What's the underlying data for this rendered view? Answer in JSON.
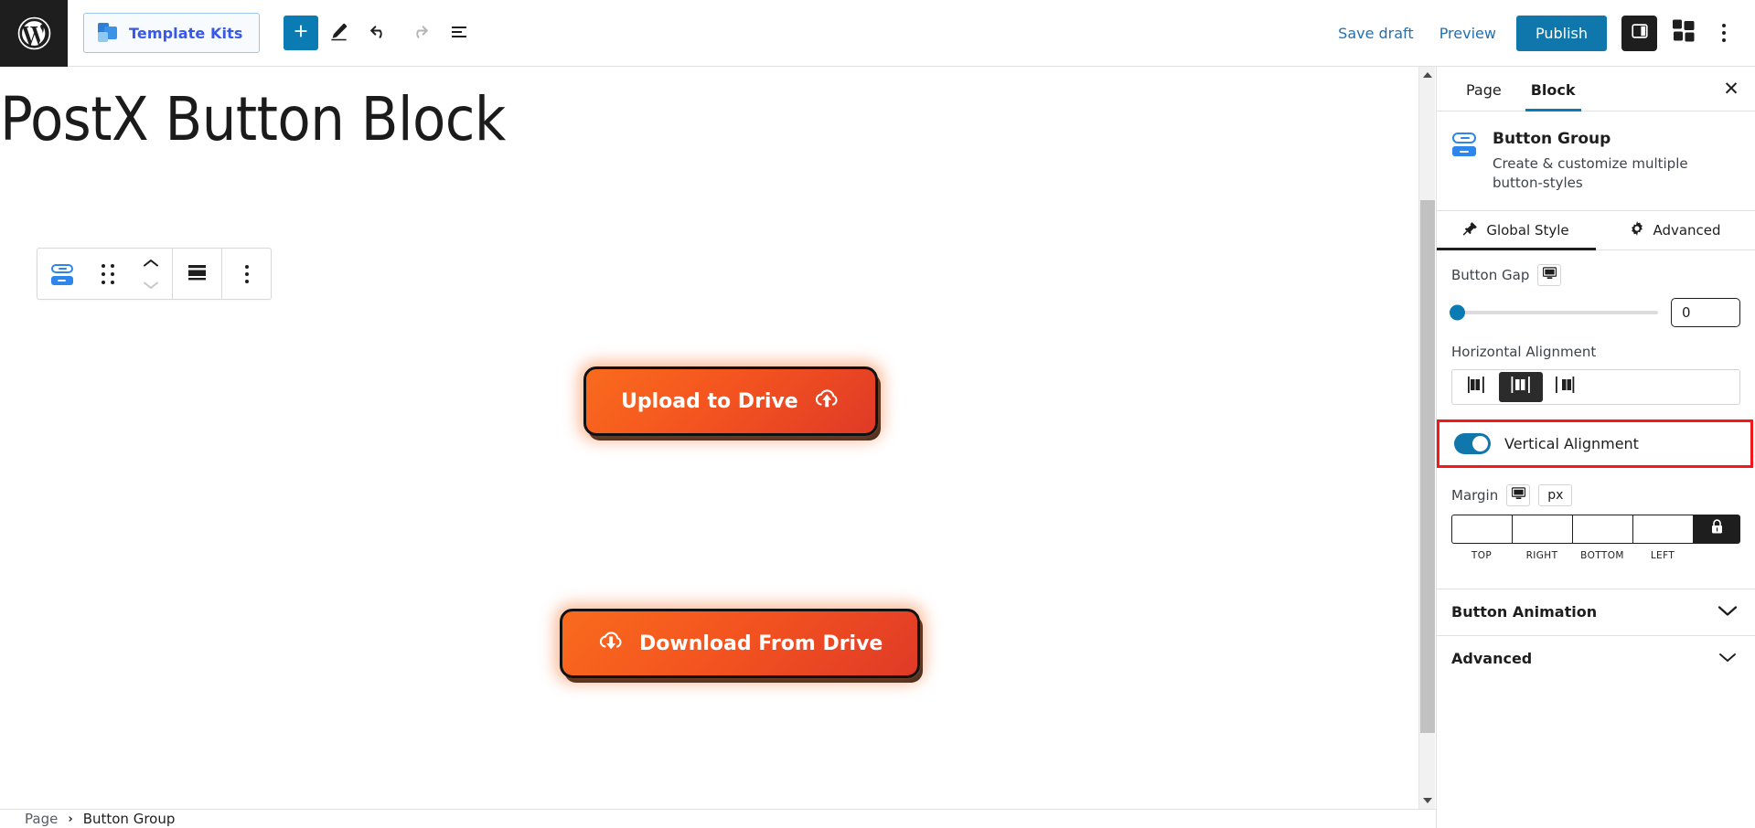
{
  "topbar": {
    "wp_logo": "wordpress-logo",
    "template_kits_label": "Template Kits",
    "add_block_label": "+",
    "icons": [
      "plus-icon",
      "edit-pencil-icon",
      "undo-icon",
      "redo-icon",
      "list-view-icon"
    ],
    "save_draft_label": "Save draft",
    "preview_label": "Preview",
    "publish_label": "Publish",
    "settings_toggle": "sidebar-toggle-icon",
    "blocks_icon": "blocks-grid-icon",
    "options_icon": "more-options-icon"
  },
  "canvas": {
    "post_title": "PostX Button Block",
    "block_toolbar": {
      "block_type_icon": "button-group-icon",
      "drag_handle": "drag-handle-icon",
      "move_up": "move-up-icon",
      "move_down": "move-down-icon",
      "align_icon": "align-icon",
      "more_icon": "more-options-icon"
    },
    "buttons": [
      {
        "label": "Upload to Drive",
        "icon": "cloud-upload-icon",
        "icon_position": "right"
      },
      {
        "label": "Download From Drive",
        "icon": "cloud-download-icon",
        "icon_position": "left"
      }
    ]
  },
  "breadcrumb": {
    "items": [
      "Page",
      "Button Group"
    ],
    "separator": "›"
  },
  "sidebar": {
    "tabs": [
      {
        "label": "Page",
        "active": false
      },
      {
        "label": "Block",
        "active": true
      }
    ],
    "close_label": "✕",
    "block": {
      "name": "Button Group",
      "description": "Create & customize multiple button-styles",
      "icon": "button-group-icon"
    },
    "subtabs": [
      {
        "label": "Global Style",
        "icon": "pin-icon",
        "active": true
      },
      {
        "label": "Advanced",
        "icon": "gear-icon",
        "active": false
      }
    ],
    "button_gap": {
      "label": "Button Gap",
      "device_icon": "desktop-icon",
      "value": "0",
      "slider_percent": 0
    },
    "horizontal_alignment": {
      "label": "Horizontal Alignment",
      "options": [
        {
          "name": "align-left",
          "selected": false
        },
        {
          "name": "align-center",
          "selected": true
        },
        {
          "name": "align-right",
          "selected": false
        }
      ]
    },
    "vertical_alignment": {
      "label": "Vertical Alignment",
      "enabled": true,
      "highlight_color": "#f41818"
    },
    "margin": {
      "label": "Margin",
      "device_icon": "desktop-icon",
      "unit": "px",
      "lock_icon": "lock-icon",
      "fields": [
        {
          "side": "TOP",
          "value": ""
        },
        {
          "side": "RIGHT",
          "value": ""
        },
        {
          "side": "BOTTOM",
          "value": ""
        },
        {
          "side": "LEFT",
          "value": ""
        }
      ]
    },
    "accordions": [
      {
        "label": "Button Animation",
        "expanded": false
      },
      {
        "label": "Advanced",
        "expanded": false
      }
    ]
  },
  "colors": {
    "brand_blue": "#0b7cb3",
    "link_blue": "#2171b1",
    "template_kits_purple": "#3858e9",
    "button_orange_start": "#f96b1e",
    "button_orange_end": "#e03a27",
    "highlight_red": "#f41818",
    "dark": "#1e1e1e"
  }
}
